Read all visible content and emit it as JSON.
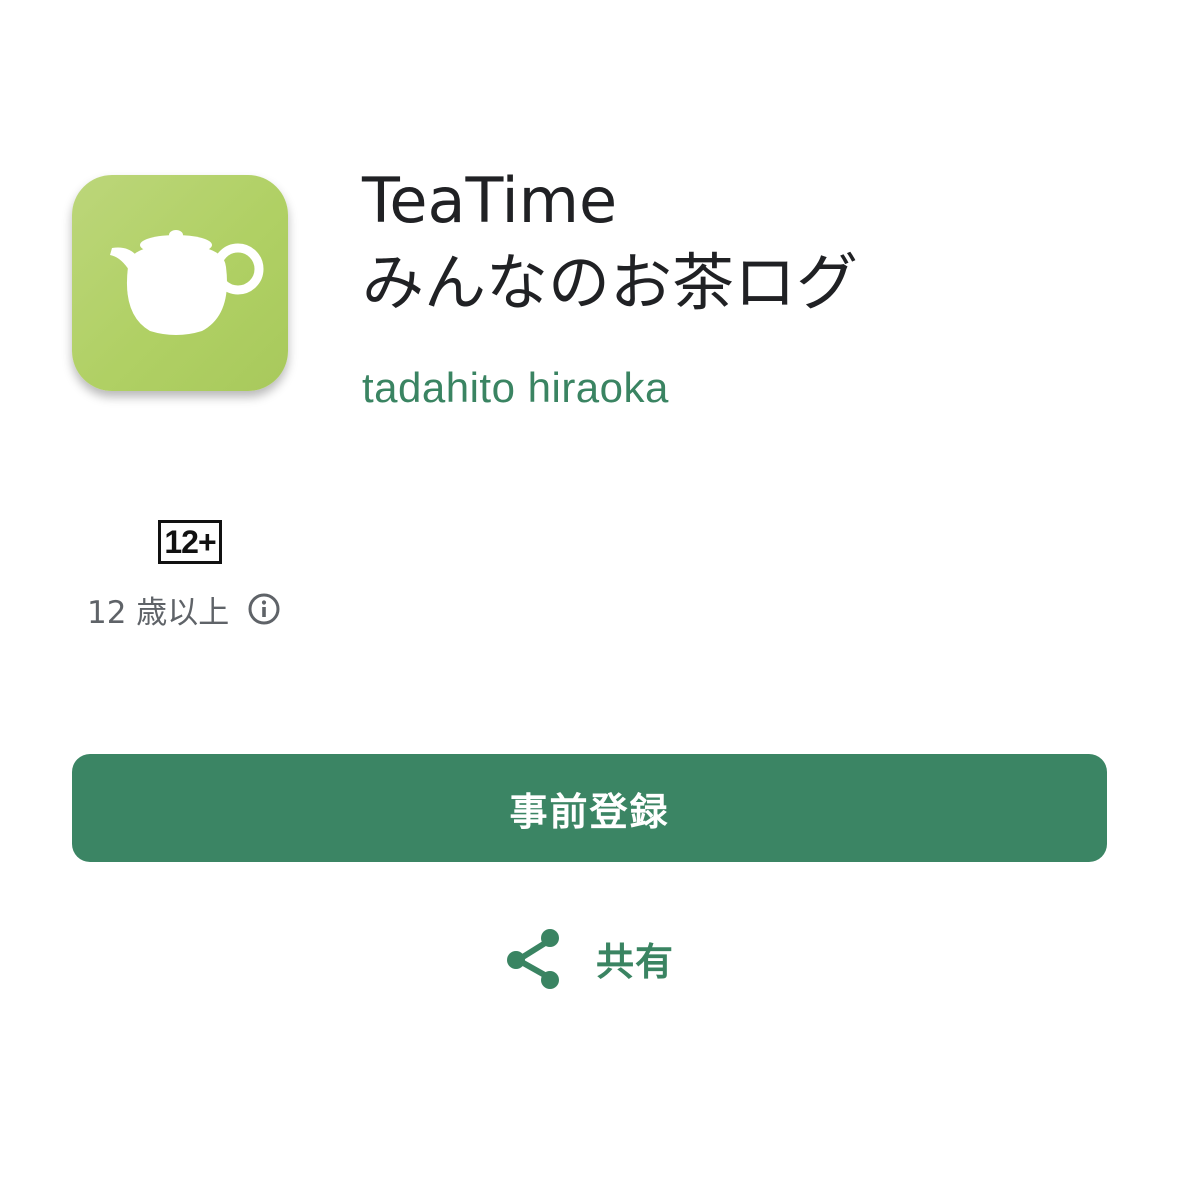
{
  "app": {
    "title_line1": "TeaTime",
    "title_line2": "みんなのお茶ログ",
    "developer": "tadahito hiraoka",
    "icon": "teapot-icon"
  },
  "content_rating": {
    "badge": "12+",
    "label": "12 歳以上",
    "info_icon": "info-icon"
  },
  "actions": {
    "preregister_label": "事前登録",
    "share_label": "共有",
    "share_icon": "share-icon"
  },
  "colors": {
    "accent": "#3b8564",
    "developer_text": "#3a8462",
    "icon_background": "#b0d064",
    "title_text": "#202124",
    "secondary_text": "#5f6368"
  }
}
